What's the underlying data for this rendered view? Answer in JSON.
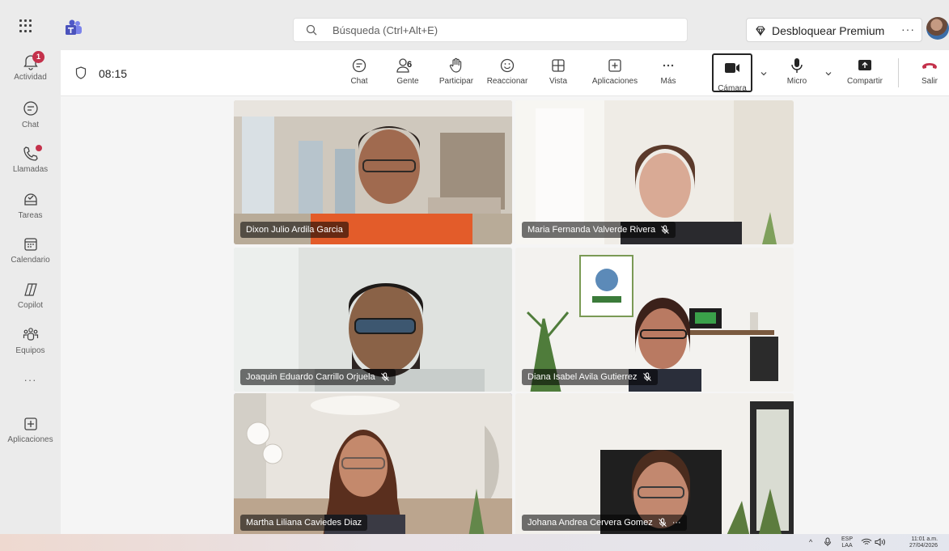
{
  "titlebar": {
    "search_placeholder": "Búsqueda (Ctrl+Alt+E)",
    "premium_label": "Desbloquear Premium",
    "premium_more": "···"
  },
  "rail": {
    "items": [
      {
        "label": "Actividad",
        "icon": "bell-icon",
        "badge": "1"
      },
      {
        "label": "Chat",
        "icon": "chat-icon"
      },
      {
        "label": "Llamadas",
        "icon": "phone-icon"
      },
      {
        "label": "Tareas",
        "icon": "tasks-icon"
      },
      {
        "label": "Calendario",
        "icon": "calendar-icon"
      },
      {
        "label": "Copilot",
        "icon": "copilot-icon"
      },
      {
        "label": "Equipos",
        "icon": "teams-icon"
      },
      {
        "label": "···",
        "icon": "more-icon"
      },
      {
        "label": "Aplicaciones",
        "icon": "apps-icon"
      }
    ]
  },
  "meeting": {
    "timer": "08:15",
    "toolbar": {
      "chat": "Chat",
      "people": "Gente",
      "people_count": "6",
      "raise": "Participar",
      "react": "Reaccionar",
      "view": "Vista",
      "apps": "Aplicaciones",
      "more": "Más",
      "camera": "Cámara",
      "mic": "Micro",
      "share": "Compartir",
      "leave": "Salir"
    }
  },
  "participants": [
    {
      "name": "Dixon Julio Ardila Garcia",
      "muted": false
    },
    {
      "name": "Maria Fernanda Valverde Rivera",
      "muted": true
    },
    {
      "name": "Joaquin Eduardo Carrillo Orjuela",
      "muted": true
    },
    {
      "name": "Diana Isabel Avila Gutierrez",
      "muted": true
    },
    {
      "name": "Martha Liliana Caviedes Diaz",
      "muted": false,
      "speaking": true
    },
    {
      "name": "Johana Andrea Cervera Gomez",
      "muted": true
    }
  ],
  "taskbar": {
    "lang_top": "ESP",
    "lang_bottom": "LAA",
    "time": "11:01 a.m.",
    "date": "27/04/2026"
  },
  "colors": {
    "accent": "#5b5fc7",
    "leave": "#c4314b",
    "badge": "#c4314b"
  }
}
